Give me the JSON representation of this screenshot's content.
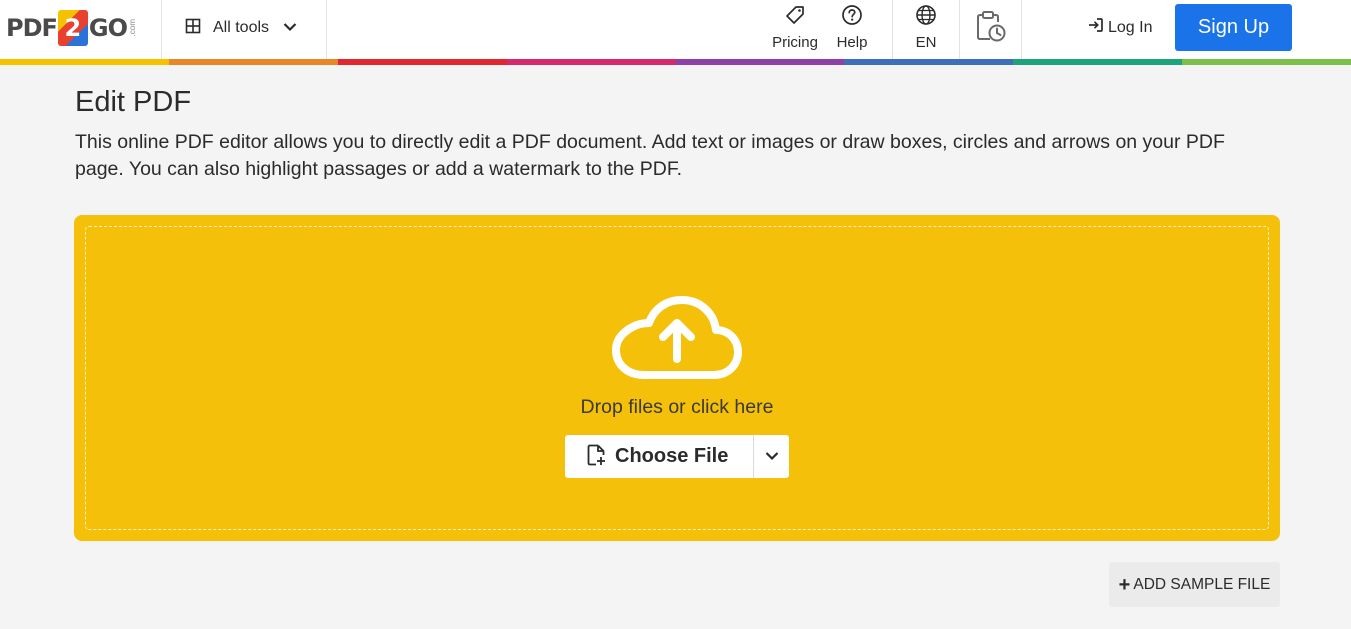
{
  "logo": {
    "text_left": "PDF",
    "text_mid": "2",
    "text_right": "GO",
    "suffix": ".com"
  },
  "header": {
    "all_tools": "All tools",
    "nav": {
      "pricing": "Pricing",
      "help": "Help",
      "language": "EN"
    },
    "history_icon": "clipboard-clock-icon",
    "login": "Log In",
    "signup": "Sign Up"
  },
  "rainbow_colors": [
    "#f6c200",
    "#e8872a",
    "#e0262e",
    "#d42a6d",
    "#8e3fa8",
    "#3f6fb8",
    "#1fa37a",
    "#7cbf4b"
  ],
  "main": {
    "title": "Edit PDF",
    "description": "This online PDF editor allows you to directly edit a PDF document. Add text or images or draw boxes, circles and arrows on your PDF page. You can also highlight passages or add a watermark to the PDF."
  },
  "dropzone": {
    "icon": "cloud-upload-icon",
    "text": "Drop files or click here",
    "choose_file": "Choose File",
    "color": "#f5c009"
  },
  "sample": {
    "label": "ADD SAMPLE FILE"
  },
  "colors": {
    "signup_bg": "#1a73e8",
    "page_bg": "#f4f4f4"
  }
}
